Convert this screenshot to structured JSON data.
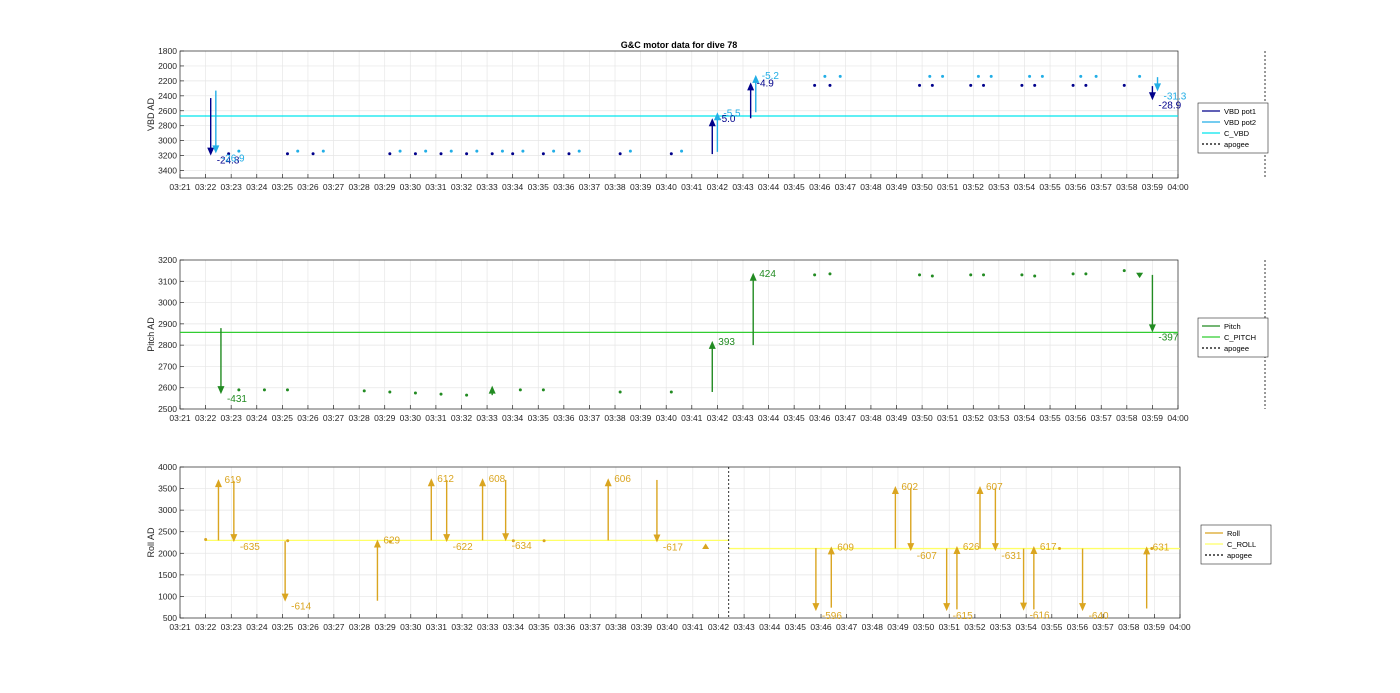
{
  "figure": {
    "title": "G&C motor data for dive 78"
  },
  "chart_data": [
    {
      "type": "line",
      "ylabel": "VBD AD",
      "ylim": [
        1800,
        3500
      ],
      "yticks": [
        1800,
        2000,
        2200,
        2400,
        2600,
        2800,
        3000,
        3200,
        3400
      ],
      "ydir": "reverse",
      "xlim": [
        "03:21",
        "04:00"
      ],
      "xticks": [
        "03:21",
        "03:22",
        "03:23",
        "03:24",
        "03:25",
        "03:26",
        "03:27",
        "03:28",
        "03:29",
        "03:30",
        "03:31",
        "03:32",
        "03:33",
        "03:34",
        "03:35",
        "03:36",
        "03:37",
        "03:38",
        "03:39",
        "03:40",
        "03:41",
        "03:42",
        "03:43",
        "03:44",
        "03:45",
        "03:46",
        "03:47",
        "03:48",
        "03:49",
        "03:50",
        "03:51",
        "03:52",
        "03:53",
        "03:54",
        "03:55",
        "03:56",
        "03:57",
        "03:58",
        "03:59",
        "04:00"
      ],
      "grid": true,
      "legend": {
        "position": "right",
        "entries": [
          "VBD pot1",
          "VBD pot2",
          "C_VBD",
          "apogee"
        ]
      },
      "colors": {
        "VBD pot1": "#00008b",
        "VBD pot2": "#22aee6",
        "C_VBD": "#00e5ee",
        "apogee": "#000000"
      },
      "reference_line": {
        "name": "C_VBD",
        "y": 2670
      },
      "apogee_x": 42.4,
      "series": [
        {
          "name": "VBD pot1",
          "x": [
            1.9,
            4.2,
            5.2,
            8.2,
            9.2,
            10.2,
            11.2,
            12.2,
            13.0,
            14.2,
            15.2,
            17.2,
            19.2,
            24.8,
            25.4,
            28.9,
            29.4,
            30.9,
            31.4,
            32.9,
            33.4,
            34.9,
            35.4,
            36.9
          ],
          "y": [
            3175,
            3175,
            3175,
            3175,
            3175,
            3175,
            3175,
            3175,
            3175,
            3175,
            3175,
            3175,
            3175,
            2260,
            2260,
            2260,
            2260,
            2260,
            2260,
            2260,
            2260,
            2260,
            2260,
            2260
          ]
        },
        {
          "name": "VBD pot2",
          "x": [
            2.3,
            4.6,
            5.6,
            8.6,
            9.6,
            10.6,
            11.6,
            12.6,
            13.4,
            14.6,
            15.6,
            17.6,
            19.6,
            25.2,
            25.8,
            29.3,
            29.8,
            31.2,
            31.7,
            33.2,
            33.7,
            35.2,
            35.8,
            37.5
          ],
          "y": [
            3140,
            3140,
            3140,
            3140,
            3140,
            3140,
            3140,
            3140,
            3140,
            3140,
            3140,
            3140,
            3140,
            2140,
            2140,
            2140,
            2140,
            2140,
            2140,
            2140,
            2140,
            2140,
            2140,
            2140
          ]
        }
      ],
      "arrows": [
        {
          "series": "VBD pot1",
          "x": 1.2,
          "y_from": 2430,
          "y_to": 3200,
          "label": "-24.8"
        },
        {
          "series": "VBD pot2",
          "x": 1.4,
          "y_from": 2330,
          "y_to": 3170,
          "label": "-26.9"
        },
        {
          "series": "VBD pot1",
          "x": 20.8,
          "y_from": 3180,
          "y_to": 2700,
          "label": "-5.0"
        },
        {
          "series": "VBD pot2",
          "x": 21.0,
          "y_from": 3150,
          "y_to": 2620,
          "label": "-5.5"
        },
        {
          "series": "VBD pot1",
          "x": 22.3,
          "y_from": 2700,
          "y_to": 2220,
          "label": "-4.9"
        },
        {
          "series": "VBD pot2",
          "x": 22.5,
          "y_from": 2620,
          "y_to": 2120,
          "label": "-5.2"
        },
        {
          "series": "VBD pot1",
          "x": 38.0,
          "y_from": 2270,
          "y_to": 2460,
          "label": "-28.9"
        },
        {
          "series": "VBD pot2",
          "x": 38.2,
          "y_from": 2150,
          "y_to": 2340,
          "label": "-31.3"
        }
      ]
    },
    {
      "type": "line",
      "ylabel": "Pitch AD",
      "ylim": [
        2500,
        3200
      ],
      "yticks": [
        2500,
        2600,
        2700,
        2800,
        2900,
        3000,
        3100,
        3200
      ],
      "xlim": [
        "03:21",
        "04:00"
      ],
      "grid": true,
      "legend": {
        "position": "right",
        "entries": [
          "Pitch",
          "C_PITCH",
          "apogee"
        ]
      },
      "colors": {
        "Pitch": "#228b22",
        "C_PITCH": "#32cd32",
        "apogee": "#000000"
      },
      "reference_line": {
        "name": "C_PITCH",
        "y": 2860
      },
      "apogee_x": 42.4,
      "series": [
        {
          "name": "Pitch",
          "x": [
            2.3,
            3.3,
            4.2,
            7.2,
            8.2,
            9.2,
            10.2,
            11.2,
            12.2,
            13.3,
            14.2,
            17.2,
            19.2,
            24.8,
            25.4,
            28.9,
            29.4,
            30.9,
            31.4,
            32.9,
            33.4,
            34.9,
            35.4,
            36.9
          ],
          "y": [
            2590,
            2590,
            2590,
            2585,
            2580,
            2575,
            2570,
            2565,
            2580,
            2590,
            2590,
            2580,
            2580,
            3130,
            3135,
            3130,
            3125,
            3130,
            3130,
            3130,
            3125,
            3135,
            3135,
            3150
          ]
        }
      ],
      "arrows": [
        {
          "series": "Pitch",
          "x": 1.6,
          "y_from": 2880,
          "y_to": 2570,
          "label": "-431"
        },
        {
          "series": "Pitch",
          "x": 20.8,
          "y_from": 2580,
          "y_to": 2820,
          "label": "393"
        },
        {
          "series": "Pitch",
          "x": 22.4,
          "y_from": 2800,
          "y_to": 3140,
          "label": "424"
        },
        {
          "series": "Pitch",
          "x": 38.0,
          "y_from": 3130,
          "y_to": 2860,
          "label": "-397"
        },
        {
          "series": "Pitch",
          "x": 12.2,
          "y_from": 2565,
          "y_to": 2610,
          "label": ""
        },
        {
          "series": "Pitch",
          "x": 37.5,
          "y_from": 3140,
          "y_to": 3115,
          "label": ""
        }
      ]
    },
    {
      "type": "line",
      "ylabel": "Roll AD",
      "ylim": [
        500,
        4000
      ],
      "yticks": [
        500,
        1000,
        1500,
        2000,
        2500,
        3000,
        3500,
        4000
      ],
      "xlim": [
        "03:21",
        "04:00"
      ],
      "grid": true,
      "legend": {
        "position": "right",
        "entries": [
          "Roll",
          "C_ROLL",
          "apogee"
        ]
      },
      "colors": {
        "Roll": "#daa520",
        "C_ROLL": "#ffff66",
        "apogee": "#000000"
      },
      "reference_line_segments": [
        {
          "name": "C_ROLL",
          "x_from": 1.0,
          "x_to": 21.4,
          "y": 2300
        },
        {
          "name": "C_ROLL",
          "x_from": 21.4,
          "x_to": 39.0,
          "y": 2110
        }
      ],
      "apogee_x": 21.4,
      "series": [
        {
          "name": "Roll",
          "x": [
            1.0,
            4.2,
            8.2,
            13.0,
            14.2,
            34.3,
            37.9
          ],
          "y": [
            2320,
            2290,
            2270,
            2290,
            2290,
            2110,
            2110
          ]
        }
      ],
      "arrows": [
        {
          "series": "Roll",
          "x": 1.5,
          "y_from": 2300,
          "y_to": 3720,
          "label": "619"
        },
        {
          "series": "Roll",
          "x": 2.1,
          "y_from": 3680,
          "y_to": 2260,
          "label": "-635"
        },
        {
          "series": "Roll",
          "x": 4.1,
          "y_from": 2280,
          "y_to": 880,
          "label": "-614"
        },
        {
          "series": "Roll",
          "x": 7.7,
          "y_from": 900,
          "y_to": 2320,
          "label": "629"
        },
        {
          "series": "Roll",
          "x": 9.8,
          "y_from": 2300,
          "y_to": 3740,
          "label": "612"
        },
        {
          "series": "Roll",
          "x": 10.4,
          "y_from": 3700,
          "y_to": 2260,
          "label": "-622"
        },
        {
          "series": "Roll",
          "x": 11.8,
          "y_from": 2300,
          "y_to": 3740,
          "label": "608"
        },
        {
          "series": "Roll",
          "x": 12.7,
          "y_from": 3700,
          "y_to": 2280,
          "label": "-634"
        },
        {
          "series": "Roll",
          "x": 16.7,
          "y_from": 2300,
          "y_to": 3740,
          "label": "606"
        },
        {
          "series": "Roll",
          "x": 18.6,
          "y_from": 3700,
          "y_to": 2250,
          "label": "-617"
        },
        {
          "series": "Roll",
          "x": 20.5,
          "y_from": 2100,
          "y_to": 2230,
          "label": ""
        },
        {
          "series": "Roll",
          "x": 24.8,
          "y_from": 2120,
          "y_to": 660,
          "label": "-596"
        },
        {
          "series": "Roll",
          "x": 25.4,
          "y_from": 740,
          "y_to": 2160,
          "label": "609"
        },
        {
          "series": "Roll",
          "x": 27.9,
          "y_from": 2110,
          "y_to": 3560,
          "label": "602"
        },
        {
          "series": "Roll",
          "x": 28.5,
          "y_from": 3520,
          "y_to": 2050,
          "label": "-607"
        },
        {
          "series": "Roll",
          "x": 29.9,
          "y_from": 2110,
          "y_to": 660,
          "label": "-615"
        },
        {
          "series": "Roll",
          "x": 30.3,
          "y_from": 700,
          "y_to": 2170,
          "label": "626"
        },
        {
          "series": "Roll",
          "x": 31.2,
          "y_from": 2110,
          "y_to": 3560,
          "label": "607"
        },
        {
          "series": "Roll",
          "x": 31.8,
          "y_from": 3520,
          "y_to": 2050,
          "label": "-631"
        },
        {
          "series": "Roll",
          "x": 32.9,
          "y_from": 2110,
          "y_to": 670,
          "label": "-616"
        },
        {
          "series": "Roll",
          "x": 33.3,
          "y_from": 700,
          "y_to": 2170,
          "label": "617"
        },
        {
          "series": "Roll",
          "x": 35.2,
          "y_from": 2110,
          "y_to": 660,
          "label": "-640"
        },
        {
          "series": "Roll",
          "x": 37.7,
          "y_from": 720,
          "y_to": 2160,
          "label": "631"
        }
      ]
    }
  ]
}
